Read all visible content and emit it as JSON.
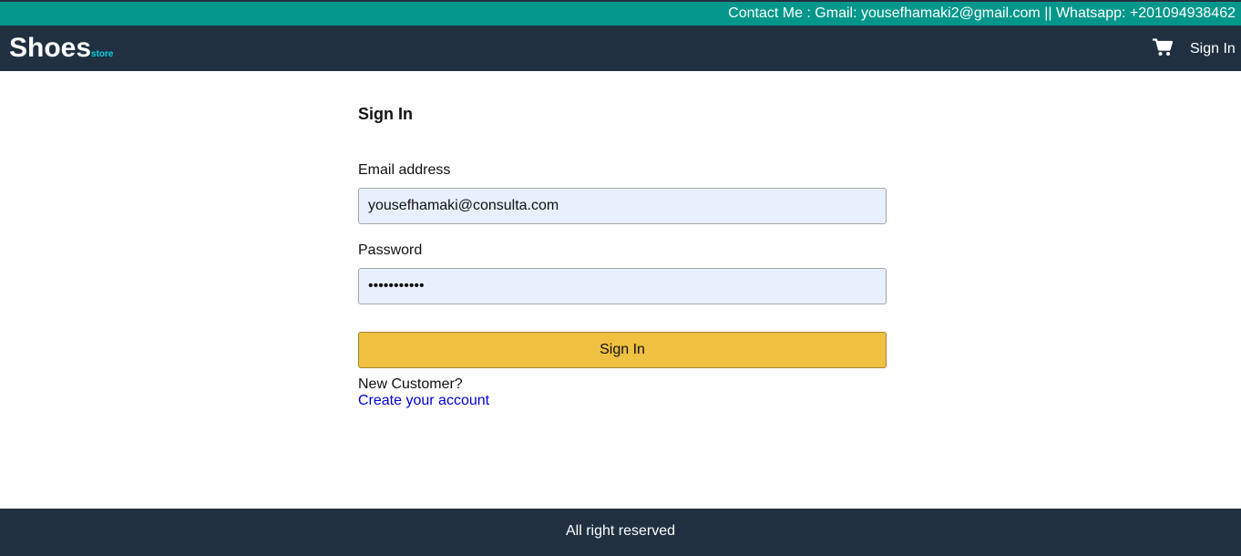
{
  "contact_bar": {
    "text": "Contact Me : Gmail: yousefhamaki2@gmail.com || Whatsapp: +201094938462"
  },
  "navbar": {
    "brand": "Shoes",
    "brand_sub": "store",
    "cart_icon": "cart-icon",
    "signin_label": "Sign In"
  },
  "signin_form": {
    "title": "Sign In",
    "email_label": "Email address",
    "email_value": "yousefhamaki@consulta.com",
    "password_label": "Password",
    "password_value": "•••••••••••",
    "submit_label": "Sign In",
    "new_customer_text": "New Customer?",
    "create_account_link": "Create your account"
  },
  "footer": {
    "text": "All right reserved"
  },
  "colors": {
    "contact_bar_bg": "#02978a",
    "navbar_bg": "#203040",
    "brand_sub": "#00d3e0",
    "input_bg": "#e8f0fe",
    "button_bg": "#f0c040",
    "link": "#0000d8"
  }
}
